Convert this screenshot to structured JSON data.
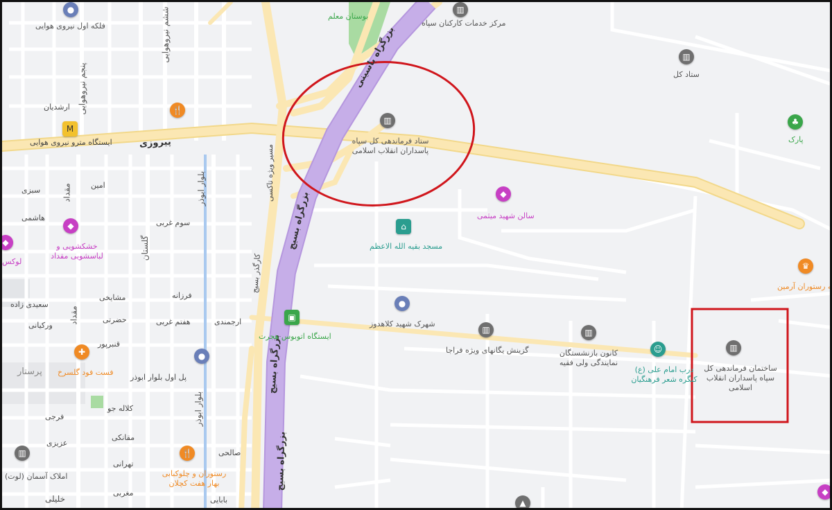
{
  "map": {
    "roads": {
      "pirouzi": "پیروزی",
      "yasini": "بزرگراه یاسینی",
      "basij_1": "بزرگراه بسیج",
      "basij_2": "بزرگراه بسیج",
      "basij_3": "بزرگراه بسیج",
      "basij_lane": "مسیر ویژه تاکسی",
      "karegar_basij": "کارگذر بسیج",
      "bolvar_abouzar_1": "بلوار ابوذر",
      "bolvar_abouzar_2": "بلوار ابوذر",
      "golestan": "گلستان",
      "meghdad_1": "مقداد",
      "meghdad_2": "مقداد",
      "panjom": "پنجم نیروهوایی",
      "sheshom": "ششم نیروهوایی",
      "parastar": "پرستار"
    },
    "streets": [
      "ارشدیان",
      "سبزی",
      "امین",
      "هاشمی",
      "سوم غربی",
      "مشایخی",
      "فرزانه",
      "سعیدی زاده",
      "حضرتی",
      "ارجمندی",
      "هفتم غربی",
      "ورکیانی",
      "قنبرپور",
      "کلاله جو",
      "فرجی",
      "مقانکی",
      "عزیزی",
      "تهرانی",
      "صالحی",
      "مغربی",
      "خلیلی",
      "بابایی",
      "پل اول بلوار ابوذر"
    ],
    "pois": {
      "flight_1": "فلکه اول نیروی هوایی",
      "metro": "ایستگاه مترو نیروی هوایی",
      "bostan": "بوستان معلم",
      "markaz": "مرکز خدمات کارکنان سپاه",
      "setad_kol": "ستاد کل",
      "setad_farmandehi": "ستاد فرماندهی کل سپاه پاسداران انقلاب اسلامی",
      "park": "پارک",
      "salon": "سالن شهید میثمی",
      "masjed": "مسجد بقیه الله الاعظم",
      "restoran_armin": "کافه رستوران آرمین",
      "bus_station": "ایستگاه اتوبوس هجرت",
      "shahrak": "شهرک شهید کلاهدوز",
      "gozinesh": "گزینش یگانهای ویژه فراجا",
      "kanoon": "کانون بازنشستگان نمایندگی ولی فقیه",
      "dar_imam": "درب امام علی (ع) کنگره شعر فرهنگیان",
      "sakhteman": "ساختمان فرماندهی کل سپاه پاسداران انقلاب اسلامی",
      "khoshkshoyi": "خشکشویی و لباسشویی مقداد",
      "lux": "لوکس",
      "fastfood": "فست فود گلسرخ",
      "restoran_bahar": "رستوران و چلوکبابی بهار هفت کچلان",
      "amlak": "املاک آسمان (لوت)"
    },
    "colors": {
      "background": "#f1f2f4",
      "highway": "#c6aee8",
      "primary_road": "#fbe7b3",
      "annotation": "#d0161c",
      "poi_gray": "#6f6f6f",
      "poi_pink": "#c73fc4",
      "poi_orange": "#f08a24",
      "poi_teal": "#2a9d8f",
      "poi_green": "#3aa64a",
      "poi_blue": "#6a7fb8"
    }
  }
}
